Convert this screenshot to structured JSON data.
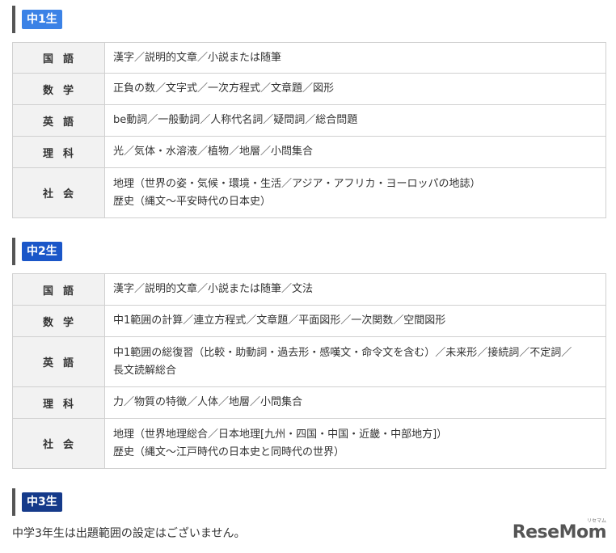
{
  "sections": [
    {
      "badge": "中1生",
      "badge_color": "#3b82e6",
      "rows": [
        {
          "subject": "国語",
          "lines": [
            "漢字／説明的文章／小説または随筆"
          ]
        },
        {
          "subject": "数学",
          "lines": [
            "正負の数／文字式／一次方程式／文章題／図形"
          ]
        },
        {
          "subject": "英語",
          "lines": [
            "be動詞／一般動詞／人称代名詞／疑問詞／総合問題"
          ]
        },
        {
          "subject": "理科",
          "lines": [
            "光／気体・水溶液／植物／地層／小問集合"
          ]
        },
        {
          "subject": "社会",
          "lines": [
            "地理（世界の姿・気候・環境・生活／アジア・アフリカ・ヨーロッパの地誌）",
            "歴史（縄文～平安時代の日本史）"
          ]
        }
      ]
    },
    {
      "badge": "中2生",
      "badge_color": "#1a56c8",
      "rows": [
        {
          "subject": "国語",
          "lines": [
            "漢字／説明的文章／小説または随筆／文法"
          ]
        },
        {
          "subject": "数学",
          "lines": [
            "中1範囲の計算／連立方程式／文章題／平面図形／一次関数／空間図形"
          ]
        },
        {
          "subject": "英語",
          "lines": [
            "中1範囲の総復習（比較・助動詞・過去形・感嘆文・命令文を含む）／未来形／接続詞／不定詞／",
            "長文読解総合"
          ]
        },
        {
          "subject": "理科",
          "lines": [
            "力／物質の特徴／人体／地層／小問集合"
          ]
        },
        {
          "subject": "社会",
          "lines": [
            "地理（世界地理総合／日本地理[九州・四国・中国・近畿・中部地方]）",
            "歴史（縄文～江戸時代の日本史と同時代の世界）"
          ]
        }
      ]
    },
    {
      "badge": "中3生",
      "badge_color": "#153a8a"
    }
  ],
  "note": "中学3年生は出題範囲の設定はございません。",
  "logo": {
    "text": "ReseMom",
    "sub": "リセマム"
  }
}
